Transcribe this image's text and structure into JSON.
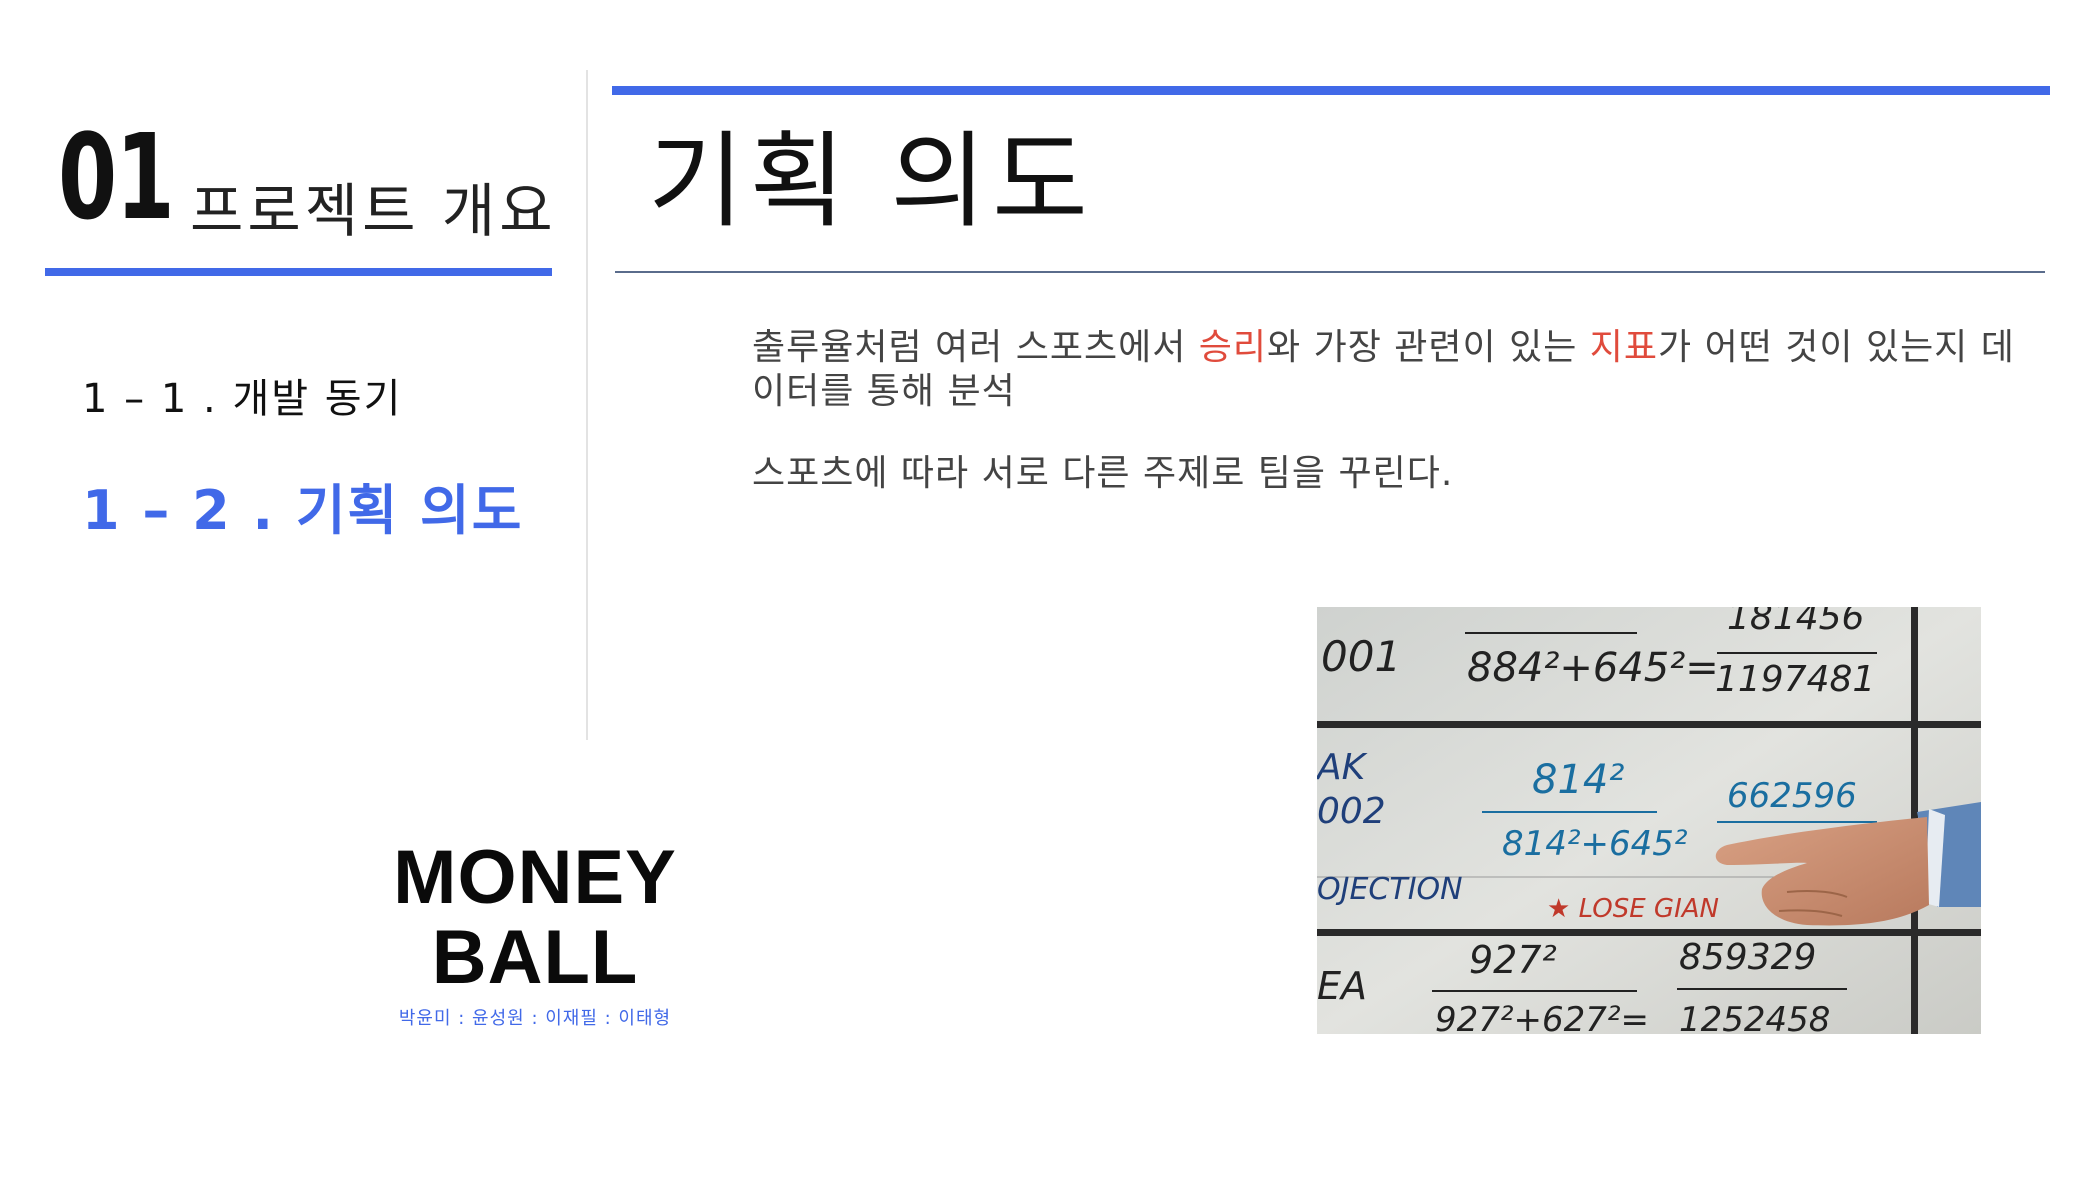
{
  "section": {
    "number": "01",
    "title": "프로젝트 개요"
  },
  "page_title": "기획 의도",
  "nav": {
    "items": [
      {
        "label": "1 – 1 . 개발 동기",
        "active": false
      },
      {
        "label": "1 – 2 . 기획 의도",
        "active": true
      }
    ]
  },
  "body": {
    "p1_part1": "출루율처럼 여러 스포츠에서 ",
    "p1_hl1": "승리",
    "p1_part2": "와 가장 관련이 있는 ",
    "p1_hl2": "지표",
    "p1_part3": "가 어떤 것이 있는지 데이터를 통해 분석",
    "p2": "스포츠에 따라 서로 다른 주제로 팀을 꾸린다."
  },
  "logo": {
    "line1": "MONEY",
    "line2": "BALL",
    "authors": "박윤미 : 윤성원 : 이재필 : 이태형"
  },
  "image": {
    "row1": {
      "label": "001",
      "num": "884²+645²=",
      "frac_top": "181456",
      "frac_bottom": "1197481"
    },
    "row2": {
      "label_a": "AK",
      "label_b": "002",
      "label_c": "OJECTION",
      "num_top": "814²",
      "num_bottom": "814²+645²",
      "result": "662596"
    },
    "note": "★ LOSE  GIAN",
    "row3": {
      "label": "EA",
      "num_top": "927²",
      "num_bottom": "927²+627²=",
      "result_top": "859329",
      "result_bottom": "1252458"
    }
  },
  "colors": {
    "accent": "#4169e8",
    "highlight": "#e04b3c",
    "text": "#444444"
  }
}
